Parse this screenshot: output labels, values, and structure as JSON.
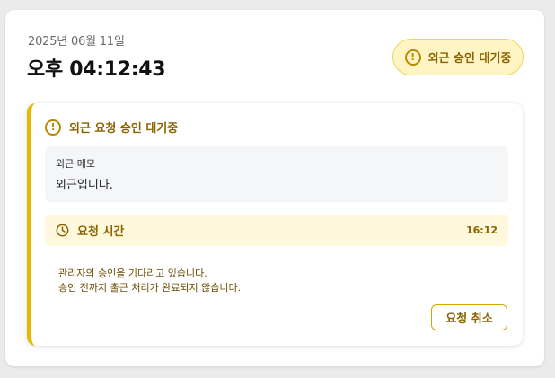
{
  "header": {
    "date": "2025년 06월 11일",
    "time": "오후 04:12:43",
    "status_badge": {
      "label": "외근 승인 대기중",
      "icon": "exclamation-circle-icon"
    }
  },
  "request_panel": {
    "title": "외근 요청 승인 대기중",
    "title_icon": "exclamation-circle-icon",
    "memo": {
      "label": "외근 메모",
      "text": "외근입니다."
    },
    "request_time": {
      "icon": "clock-icon",
      "label": "요청 시간",
      "value": "16:12"
    },
    "notice_lines": [
      "관리자의 승인을 기다리고 있습니다.",
      "승인 전까지 출근 처리가 완료되지 않습니다."
    ],
    "cancel_label": "요청 취소"
  },
  "colors": {
    "accent": "#e6b800",
    "accent_text": "#8a6300",
    "badge_bg": "#fff4c4",
    "time_box_bg": "#fff8dc",
    "memo_bg": "#f5f6f8"
  }
}
